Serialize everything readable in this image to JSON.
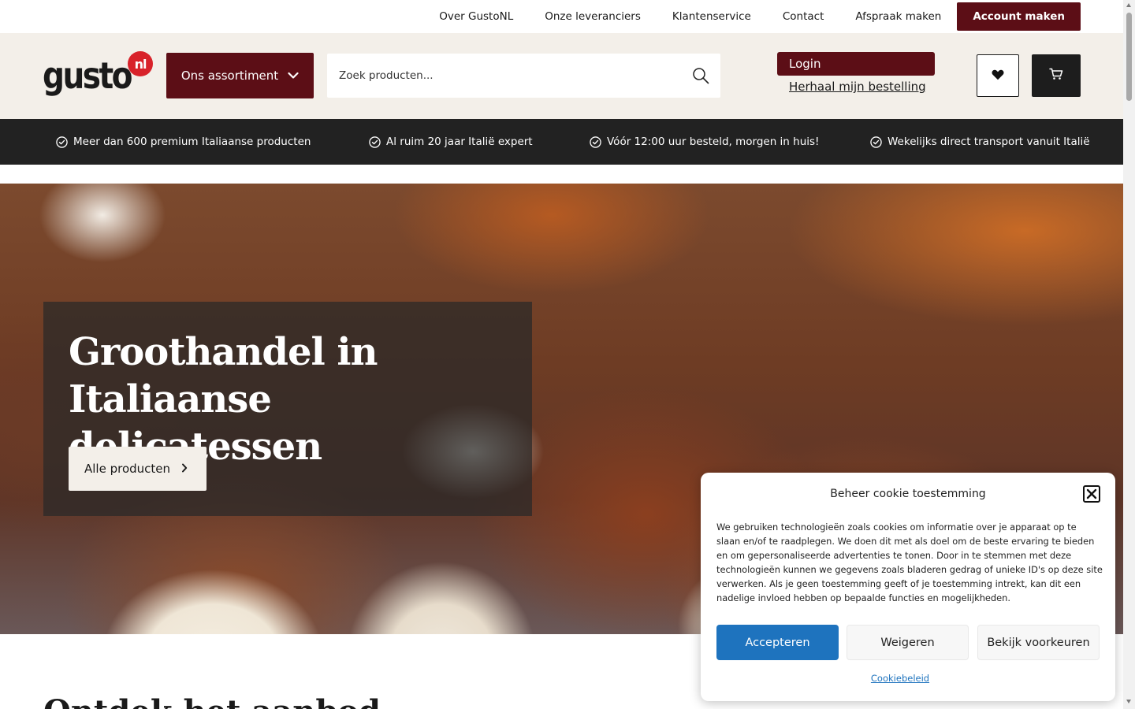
{
  "topnav": {
    "items": [
      "Over GustoNL",
      "Onze leveranciers",
      "Klantenservice",
      "Contact",
      "Afspraak maken"
    ],
    "account_label": "Account maken"
  },
  "header": {
    "logo_word": "gusto",
    "logo_badge": "nl",
    "assortiment_label": "Ons assortiment",
    "search_placeholder": "Zoek producten...",
    "login_label": "Login",
    "repeat_order_label": "Herhaal mijn bestelling"
  },
  "usps": [
    "Meer dan 600 premium Italiaanse producten",
    "Al ruim 20 jaar Italië expert",
    "Vóór 12:00 uur besteld, morgen in huis!",
    "Wekelijks direct transport vanuit Italië"
  ],
  "hero": {
    "title_line1": "Groothandel in",
    "title_line2": "Italiaanse delicatessen",
    "button_label": "Alle producten"
  },
  "section": {
    "title": "Ontdek het aanbod"
  },
  "cookie": {
    "title": "Beheer cookie toestemming",
    "text": "We gebruiken technologieën zoals cookies om informatie over je apparaat op te slaan en/of te raadplegen. We doen dit met als doel om de beste ervaring te bieden en om gepersonaliseerde advertenties te tonen. Door in te stemmen met deze technologieën kunnen we gegevens zoals bladeren gedrag of unieke ID's op deze site verwerken. Als je geen toestemming geeft of je toestemming intrekt, kan dit een nadelige invloed hebben op bepaalde functies en mogelijkheden.",
    "accept_label": "Accepteren",
    "deny_label": "Weigeren",
    "prefs_label": "Bekijk voorkeuren",
    "policy_label": "Cookiebeleid"
  },
  "colors": {
    "brand": "#5c0e16",
    "logo_red": "#d8222a",
    "usp_bar": "#222222",
    "header_bg": "#f3efe9",
    "cookie_accept": "#1e73be"
  },
  "icons": [
    "chevron-down-icon",
    "search-icon",
    "heart-icon",
    "cart-icon",
    "check-circle-icon",
    "chevron-right-icon",
    "close-icon"
  ]
}
